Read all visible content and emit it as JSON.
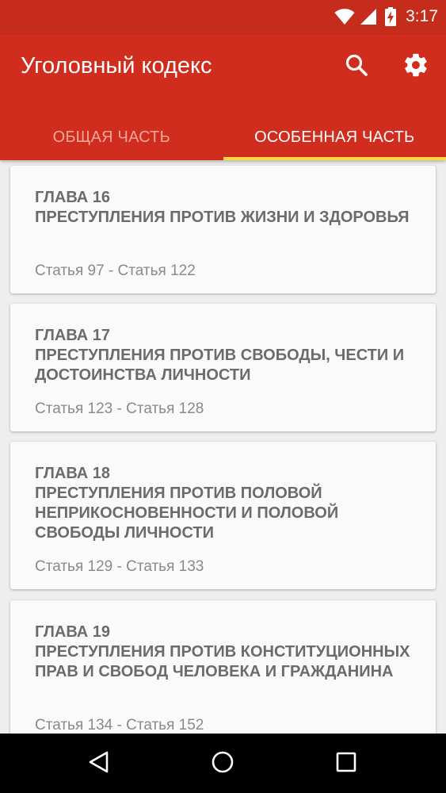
{
  "status_bar": {
    "time": "3:17"
  },
  "app_bar": {
    "title": "Уголовный кодекс",
    "search_icon": "search-icon",
    "settings_icon": "gear-icon"
  },
  "tabs": [
    {
      "label": "ОБЩАЯ ЧАСТЬ",
      "active": false
    },
    {
      "label": "ОСОБЕННАЯ ЧАСТЬ",
      "active": true
    }
  ],
  "chapters": [
    {
      "title": "ГЛАВА 16\n ПРЕСТУПЛЕНИЯ ПРОТИВ ЖИЗНИ И ЗДОРОВЬЯ",
      "articles": "Статья 97 - Статья 122"
    },
    {
      "title": "ГЛАВА 17\n ПРЕСТУПЛЕНИЯ ПРОТИВ СВОБОДЫ, ЧЕСТИ И ДОСТОИНСТВА ЛИЧНОСТИ",
      "articles": "Статья 123 - Статья 128"
    },
    {
      "title": "ГЛАВА 18\n ПРЕСТУПЛЕНИЯ ПРОТИВ ПОЛОВОЙ НЕПРИКОСНОВЕННОСТИ И ПОЛОВОЙ СВОБОДЫ ЛИЧНОСТИ",
      "articles": "Статья 129 - Статья 133"
    },
    {
      "title": "ГЛАВА 19\n ПРЕСТУПЛЕНИЯ ПРОТИВ КОНСТИТУЦИОННЫХ ПРАВ И СВОБОД ЧЕЛОВЕКА И ГРАЖДАНИНА",
      "articles": "Статья 134 - Статья 152"
    }
  ],
  "colors": {
    "primary": "#d12d1f",
    "status_bar": "#c62c1c",
    "tab_indicator": "#ffd740"
  }
}
